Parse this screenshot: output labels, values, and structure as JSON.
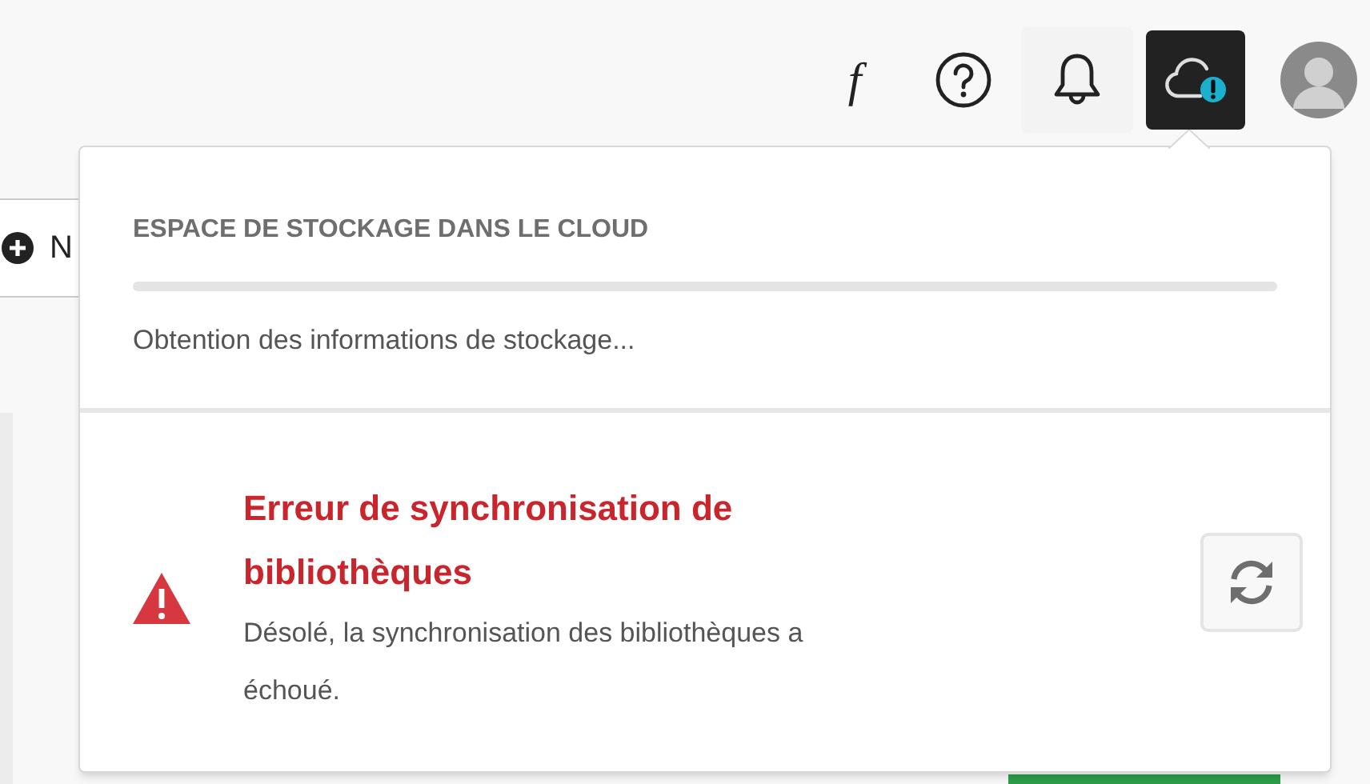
{
  "toolbar": {
    "font_button": "f",
    "cloud_status": {
      "selected": true,
      "alert": true
    }
  },
  "new_button": {
    "label": "N"
  },
  "cloud_popup": {
    "heading": "ESPACE DE STOCKAGE DANS LE CLOUD",
    "storage": {
      "level": 0
    },
    "storage_status": "Obtention des informations de stockage...",
    "error": {
      "title": "Erreur de synchronisation de bibliothèques",
      "message": "Désolé, la synchronisation des bibliothèques a échoué."
    }
  }
}
